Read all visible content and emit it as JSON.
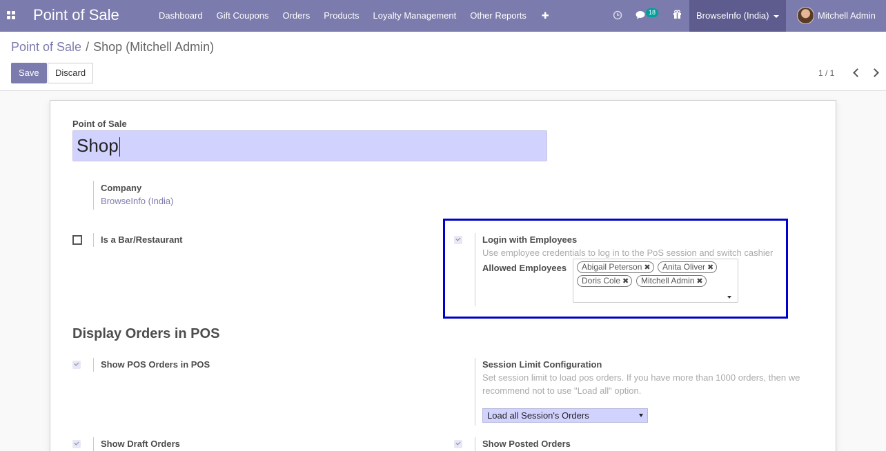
{
  "navbar": {
    "app_name": "Point of Sale",
    "menu": [
      "Dashboard",
      "Gift Coupons",
      "Orders",
      "Products",
      "Loyalty Management",
      "Other Reports"
    ],
    "plus_glyph": "✚",
    "activity_icon": "clock-icon",
    "messages_icon": "chat-icon",
    "messages_count": "18",
    "gift_icon": "gift-icon",
    "company": "BrowseInfo (India)",
    "user": "Mitchell Admin",
    "colors": {
      "primary": "#7c7bad",
      "company_bg": "#5e5c8e",
      "badge": "#00a09d"
    }
  },
  "breadcrumb": {
    "parent": "Point of Sale",
    "separator": "/",
    "current": "Shop (Mitchell Admin)"
  },
  "toolbar": {
    "save_label": "Save",
    "discard_label": "Discard"
  },
  "pager": {
    "value": "1 / 1"
  },
  "form": {
    "name_label": "Point of Sale",
    "name_value": "Shop",
    "company_label": "Company",
    "company_value": "BrowseInfo (India)",
    "is_bar_label": "Is a Bar/Restaurant",
    "is_bar_checked": false,
    "login_employees_label": "Login with Employees",
    "login_employees_checked": true,
    "login_employees_help": "Use employee credentials to log in to the PoS session and switch cashier",
    "allowed_employees_label": "Allowed Employees",
    "allowed_employees": [
      "Abigail Peterson",
      "Anita Oliver",
      "Doris Cole",
      "Mitchell Admin"
    ],
    "display_section_title": "Display Orders in POS",
    "show_pos_orders_label": "Show POS Orders in POS",
    "show_pos_orders_checked": true,
    "session_limit_label": "Session Limit Configuration",
    "session_limit_help_1": "Set session limit to load pos orders. If you have more than 1000 orders, then we",
    "session_limit_help_2": "recommend not to use \"Load all\" option.",
    "session_limit_value": "Load all Session's Orders",
    "show_draft_label": "Show Draft Orders",
    "show_draft_checked": true,
    "show_posted_label": "Show Posted Orders",
    "show_posted_checked": true,
    "highlight_color": "#0000cc"
  }
}
